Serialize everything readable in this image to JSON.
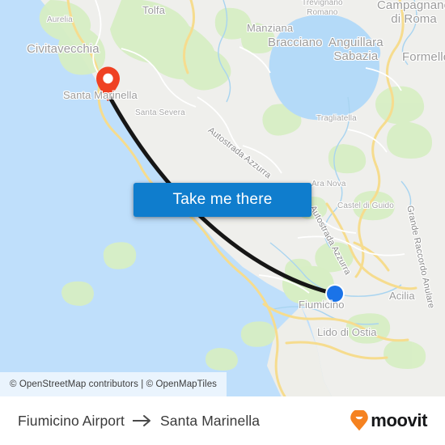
{
  "map": {
    "attribution": "© OpenStreetMap contributors | © OpenMapTiles",
    "colors": {
      "sea": "#bfdffb",
      "land": "#efefec",
      "forest": "#d7eec4",
      "road_major": "#f7dd8d",
      "road_minor": "#ffffff",
      "label": "#9a9a9a",
      "route_line": "#161616",
      "origin_dot": "#1a73e8",
      "destination_pin": "#ef4123",
      "button_blue": "#0f7dcd"
    },
    "labels": [
      {
        "text": "Tolfa",
        "size": "md"
      },
      {
        "text": "Aurelia",
        "size": "sm"
      },
      {
        "text": "Manziana",
        "size": "md"
      },
      {
        "text": "Trevignano\nRomano",
        "size": "sm"
      },
      {
        "text": "Campagnano\ndi Roma",
        "size": "lg"
      },
      {
        "text": "Civitavecchia",
        "size": "lg"
      },
      {
        "text": "Bracciano",
        "size": "lg"
      },
      {
        "text": "Anguillara\nSabazia",
        "size": "lg"
      },
      {
        "text": "Formello",
        "size": "lg"
      },
      {
        "text": "Santa Marinella",
        "size": "md"
      },
      {
        "text": "Santa Severa",
        "size": "sm"
      },
      {
        "text": "Tragliatella",
        "size": "sm"
      },
      {
        "text": "Ara Nova",
        "size": "sm"
      },
      {
        "text": "Castel di Guido",
        "size": "sm"
      },
      {
        "text": "Acilia",
        "size": "md"
      },
      {
        "text": "Fiumicino",
        "size": "md"
      },
      {
        "text": "Lido di Ostia",
        "size": "md"
      },
      {
        "text": "Autostrada Azzurra",
        "size": "road"
      },
      {
        "text": "Autostrada Azzurra",
        "size": "road"
      },
      {
        "text": "Grande Raccordo Anulare",
        "size": "road"
      }
    ],
    "markers": {
      "origin_name": "Fiumicino Airport",
      "destination_name": "Santa Marinella"
    }
  },
  "cta": {
    "label": "Take me there"
  },
  "footer": {
    "origin": "Fiumicino Airport",
    "arrow": "→",
    "destination": "Santa Marinella",
    "brand": "moovit"
  }
}
